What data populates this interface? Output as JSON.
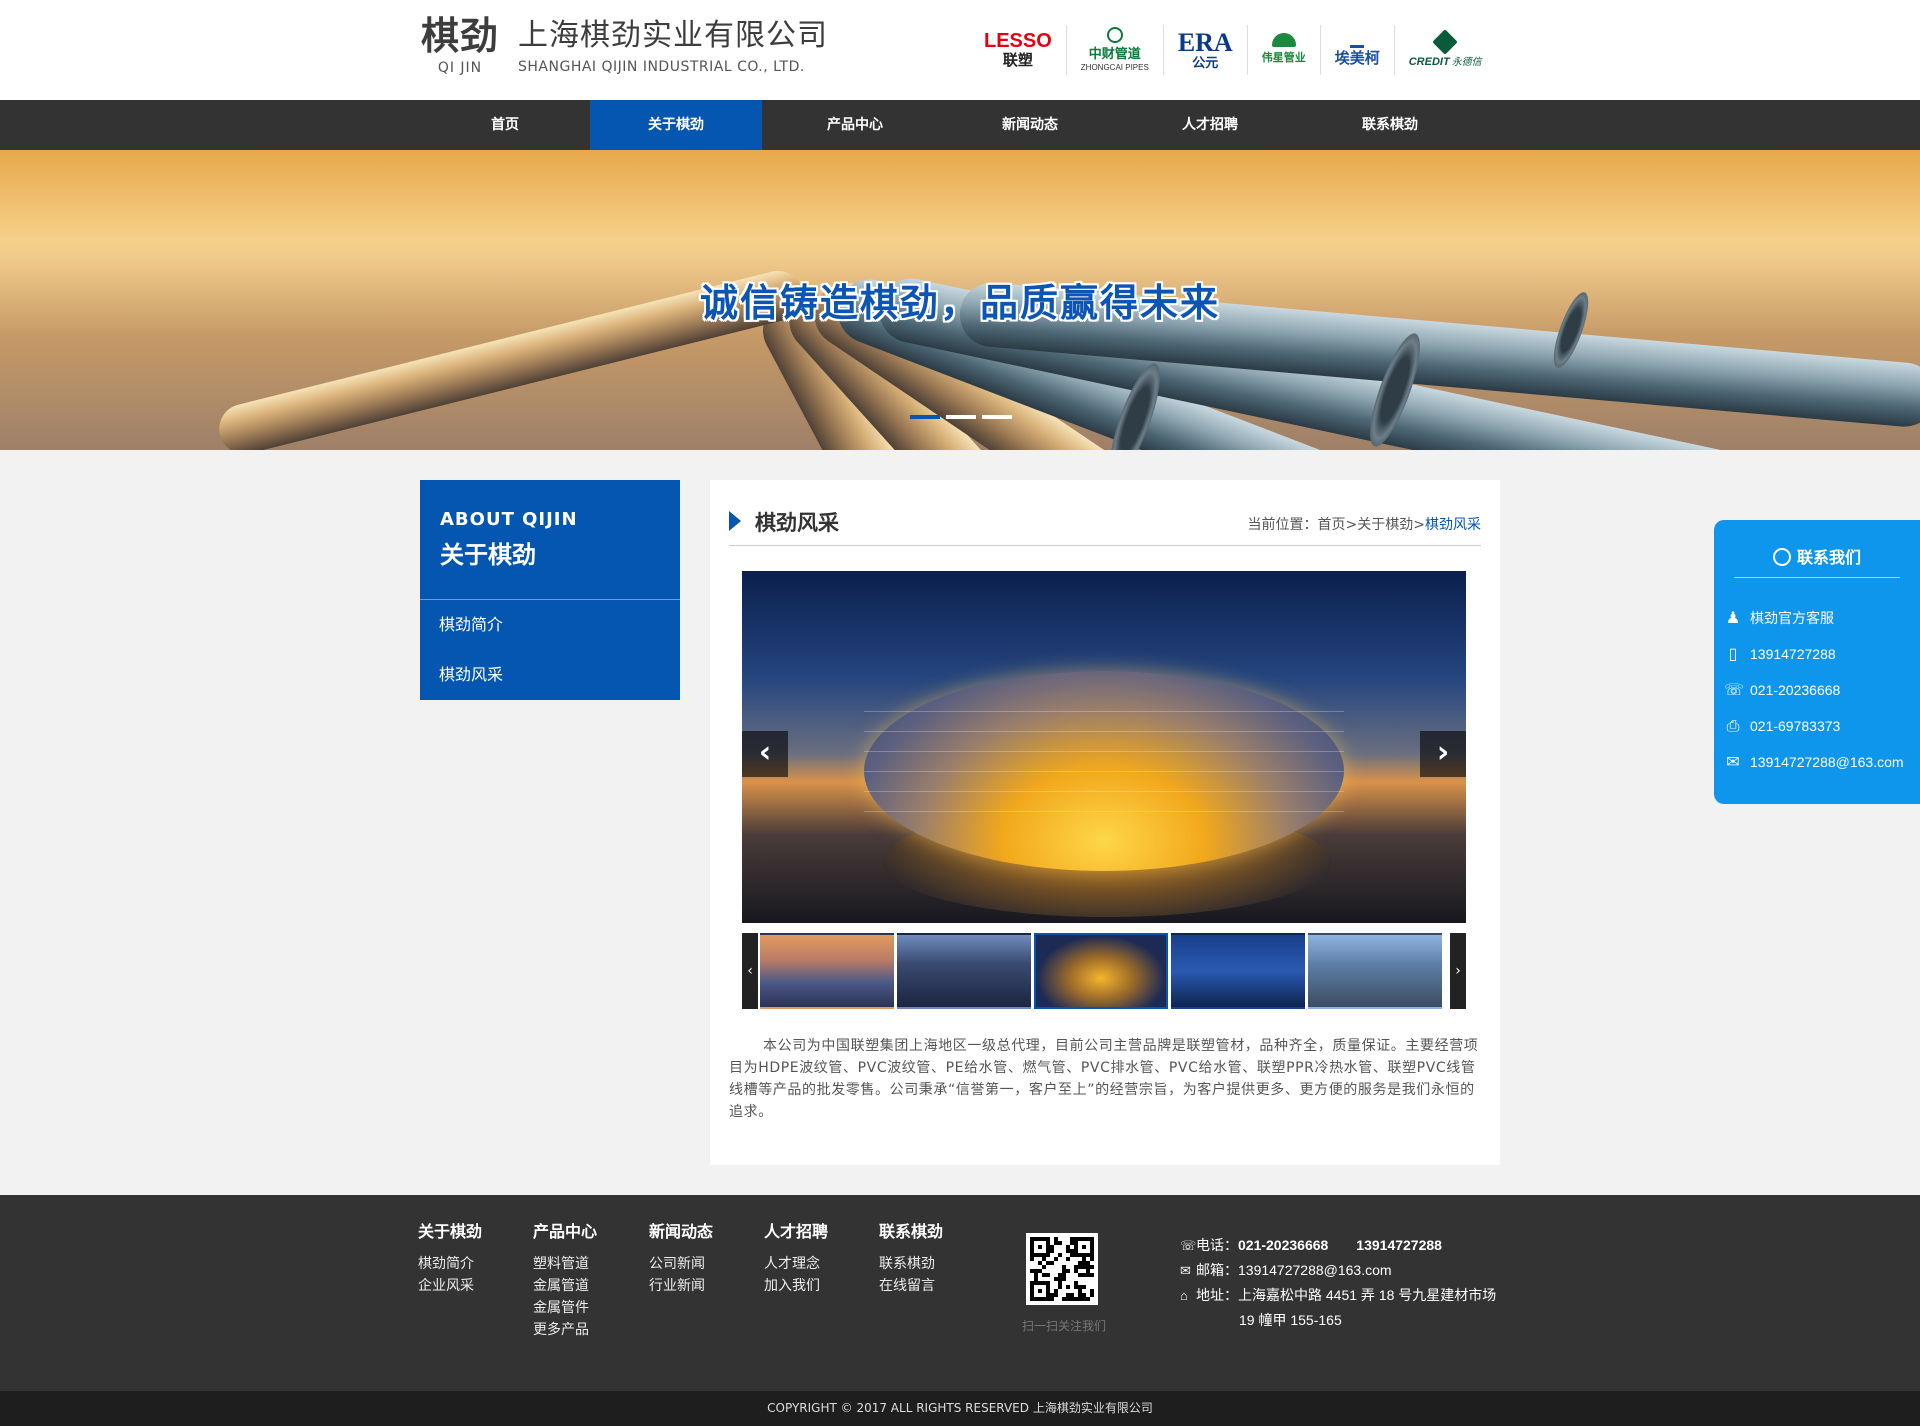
{
  "header": {
    "logo_cn": "棋劲",
    "logo_en": "QI JIN",
    "company_cn": "上海棋劲实业有限公司",
    "company_en": "SHANGHAI QIJIN INDUSTRIAL CO., LTD.",
    "brands": [
      {
        "line1": "LESSO",
        "line2": "联塑",
        "color": "#e60012"
      },
      {
        "line1": "",
        "line2": "中财管道",
        "line3": "ZHONGCAI PIPES",
        "color": "#0a7a3c"
      },
      {
        "line1": "ERA",
        "line2": "公元",
        "color": "#0b3a8a"
      },
      {
        "line1": "",
        "line2": "伟星管业",
        "color": "#1a8a3c"
      },
      {
        "line1": "",
        "line2": "埃美柯",
        "color": "#1b4fa0"
      },
      {
        "line1": "CREDIT",
        "line2": "永德信",
        "color": "#0a5a3c"
      }
    ]
  },
  "nav": {
    "items": [
      "首页",
      "关于棋劲",
      "产品中心",
      "新闻动态",
      "人才招聘",
      "联系棋劲"
    ],
    "active_index": 1,
    "active_color": "#0556b0"
  },
  "banner": {
    "slogan": "诚信铸造棋劲，品质赢得未来",
    "slide_count": 3,
    "active_slide": 0
  },
  "sidebar": {
    "title_en": "ABOUT QIJIN",
    "title_cn": "关于棋劲",
    "items": [
      "棋劲简介",
      "棋劲风采"
    ]
  },
  "content": {
    "title": "棋劲风采",
    "breadcrumb": {
      "prefix": "当前位置：",
      "items": [
        "首页",
        "关于棋劲",
        "棋劲风采"
      ],
      "separator": ">"
    },
    "gallery": {
      "prev_icon": "chevron-left-icon",
      "next_icon": "chevron-right-icon",
      "active_thumb": 2,
      "thumb_count": 5
    },
    "description": "本公司为中国联塑集团上海地区一级总代理，目前公司主营品牌是联塑管材，品种齐全，质量保证。主要经营项目为HDPE波纹管、PVC波纹管、PE给水管、燃气管、PVC排水管、PVC给水管、联塑PPR冷热水管、联塑PVC线管线槽等产品的批发零售。公司秉承“信誉第一，客户至上”的经营宗旨，为客户提供更多、更方便的服务是我们永恒的追求。"
  },
  "float_contact": {
    "title": "联系我们",
    "rows": [
      {
        "icon": "qq-icon",
        "text": "棋劲官方客服"
      },
      {
        "icon": "mobile-icon",
        "text": "13914727288"
      },
      {
        "icon": "phone-icon",
        "text": "021-20236668"
      },
      {
        "icon": "fax-icon",
        "text": "021-69783373"
      },
      {
        "icon": "mail-icon",
        "text": "13914727288@163.com"
      }
    ]
  },
  "footer": {
    "columns": [
      {
        "title": "关于棋劲",
        "links": [
          "棋劲简介",
          "企业风采"
        ]
      },
      {
        "title": "产品中心",
        "links": [
          "塑料管道",
          "金属管道",
          "金属管件",
          "更多产品"
        ]
      },
      {
        "title": "新闻动态",
        "links": [
          "公司新闻",
          "行业新闻"
        ]
      },
      {
        "title": "人才招聘",
        "links": [
          "人才理念",
          "加入我们"
        ]
      },
      {
        "title": "联系棋劲",
        "links": [
          "联系棋劲",
          "在线留言"
        ]
      }
    ],
    "qr_caption": "扫一扫关注我们",
    "phone_label": "电话：",
    "phone_value": "021-20236668　　13914727288",
    "email_label": "邮箱：",
    "email_value": "13914727288@163.com",
    "address_label": "地址：",
    "address_line1": "上海嘉松中路 4451 弄 18 号九星建材市场",
    "address_line2": "19 幢甲 155-165"
  },
  "copyright": "COPYRIGHT © 2017 ALL RIGHTS RESERVED 上海棋劲实业有限公司"
}
